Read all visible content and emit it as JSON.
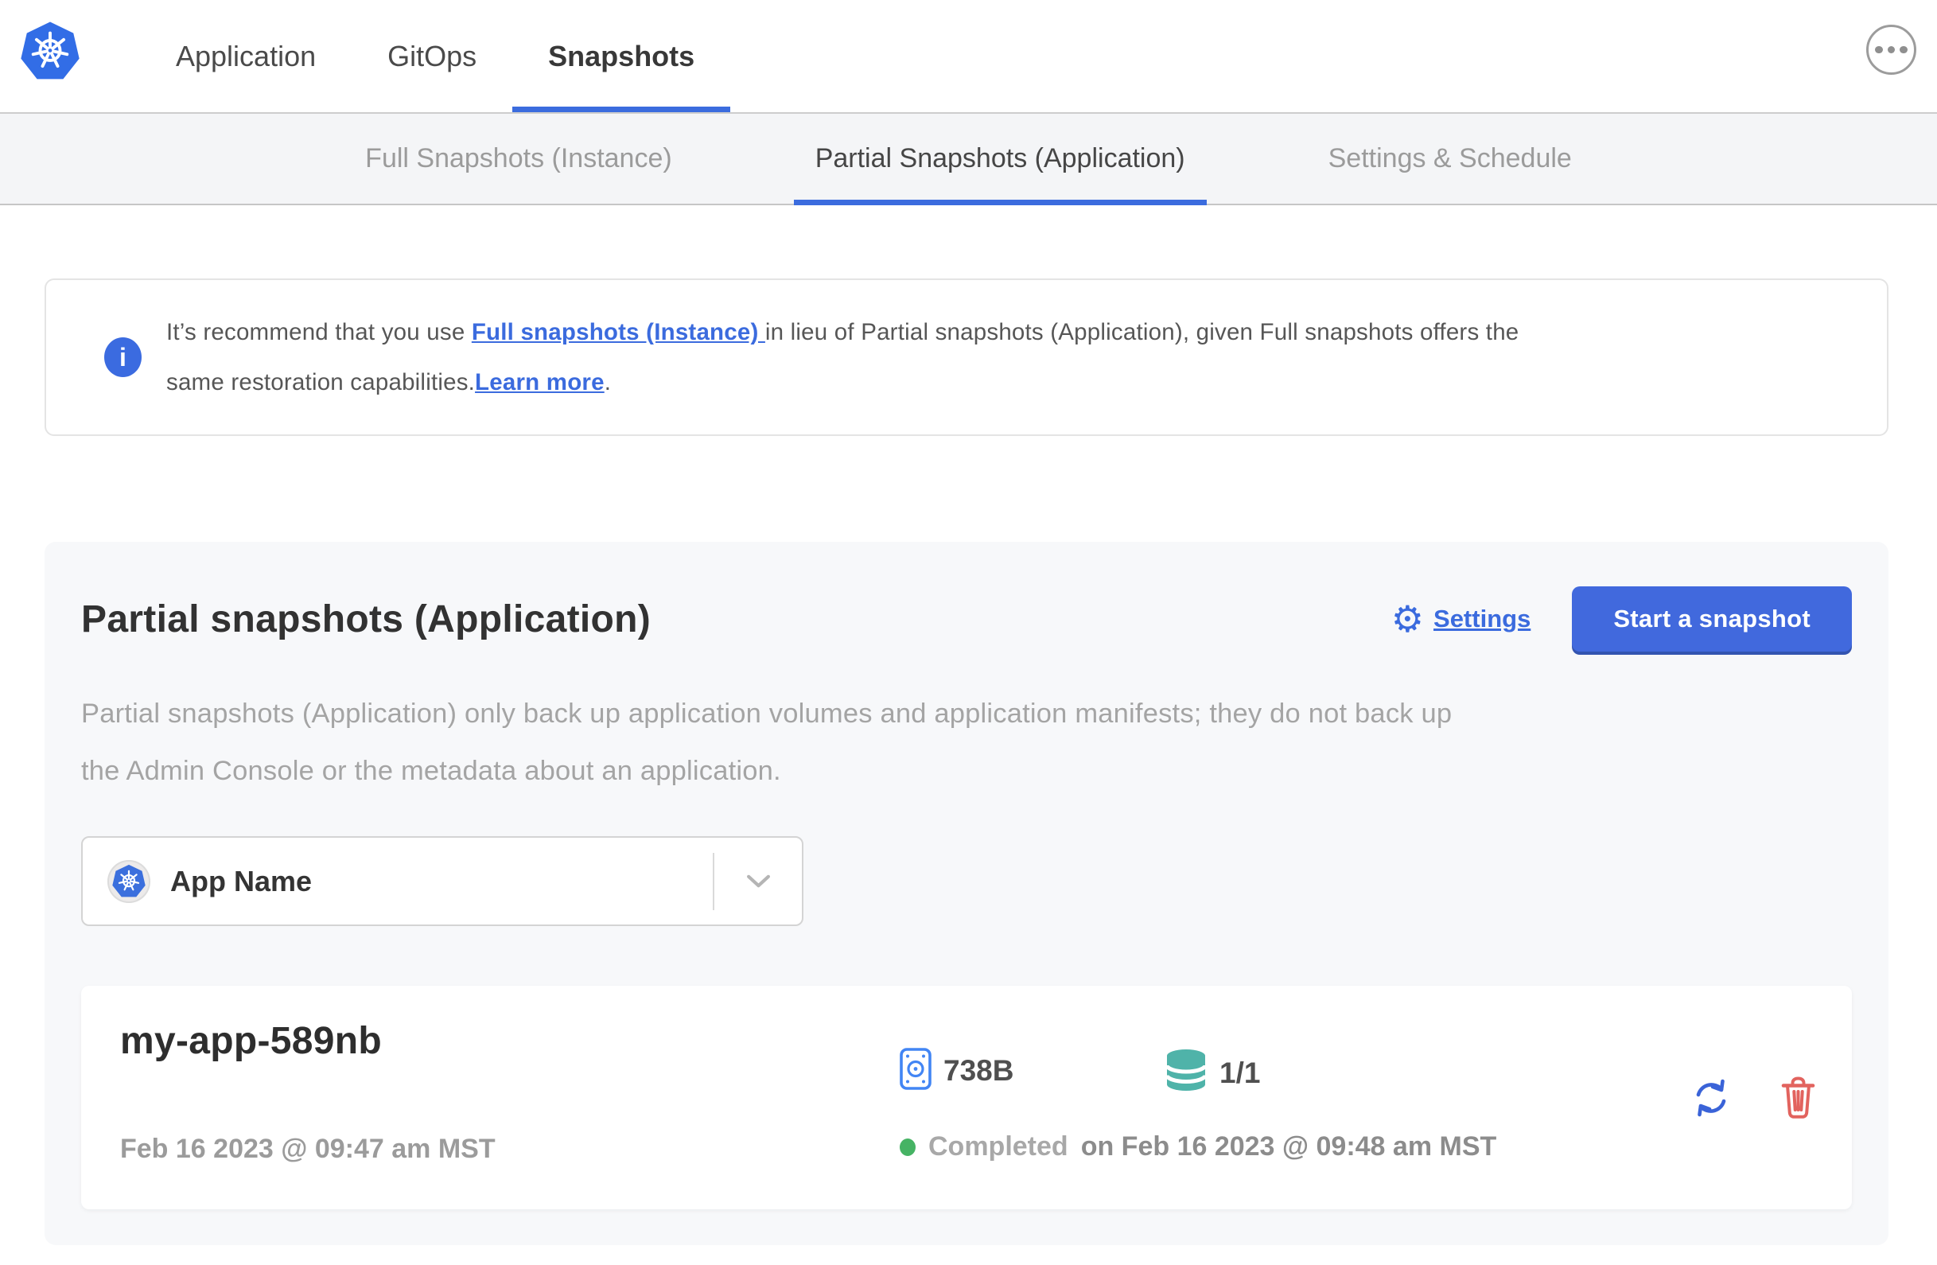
{
  "topnav": {
    "items": [
      {
        "label": "Application",
        "active": false
      },
      {
        "label": "GitOps",
        "active": false
      },
      {
        "label": "Snapshots",
        "active": true
      }
    ]
  },
  "subnav": {
    "tabs": [
      {
        "label": "Full Snapshots (Instance)",
        "active": false
      },
      {
        "label": "Partial Snapshots (Application)",
        "active": true
      },
      {
        "label": "Settings & Schedule",
        "active": false
      }
    ]
  },
  "banner": {
    "line1_pre": "It’s recommend that you use ",
    "link_full_snapshots": "Full snapshots (Instance) ",
    "line1_post": "in lieu of Partial snapshots (Application), given Full snapshots offers the",
    "line2_pre": "same restoration capabilities.",
    "link_learn_more": "Learn more",
    "line2_post": "."
  },
  "panel": {
    "title": "Partial snapshots (Application)",
    "settings_label": "Settings",
    "start_snapshot_label": "Start a snapshot",
    "description_line1": "Partial snapshots (Application) only back up application volumes and application manifests; they do not back up",
    "description_line2": "the Admin Console or the metadata about an application.",
    "app_selector": {
      "value": "App Name"
    }
  },
  "snapshot": {
    "name": "my-app-589nb",
    "started": "Feb 16 2023 @ 09:47 am MST",
    "size": "738B",
    "volumes": "1/1",
    "status": "Completed",
    "completed_at": "on Feb 16 2023 @ 09:48 am MST"
  },
  "icons": {
    "kubernetes_logo": "heptagon-helm-wheel",
    "overflow_menu": "ellipsis-circle",
    "info": "i",
    "gear": "⚙",
    "chevron_down": "chevron",
    "size": "disk-volume",
    "volumes": "database-stack",
    "status_dot": "●",
    "restore": "circular-arrows",
    "delete": "trash-can"
  },
  "colors": {
    "accent_blue": "#3b6cde",
    "kubernetes_blue": "#326de6",
    "button_blue": "#4169dd",
    "disk_icon_blue": "#4285f4",
    "volume_teal": "#4fb3a9",
    "status_green": "#46b364",
    "delete_red": "#e2635e"
  }
}
